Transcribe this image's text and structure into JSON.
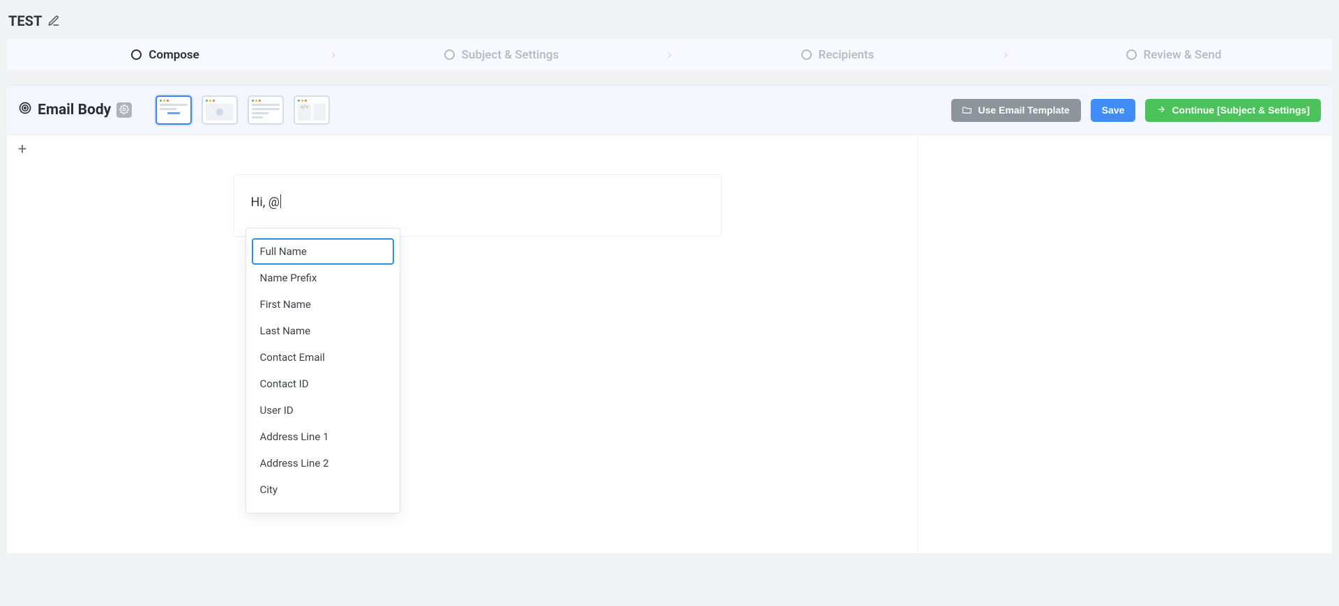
{
  "page_title": "TEST",
  "steps": [
    {
      "label": "Compose",
      "active": true
    },
    {
      "label": "Subject & Settings",
      "active": false
    },
    {
      "label": "Recipients",
      "active": false
    },
    {
      "label": "Review & Send",
      "active": false
    }
  ],
  "section_title": "Email Body",
  "buttons": {
    "use_template": "Use Email Template",
    "save": "Save",
    "continue": "Continue [Subject & Settings]"
  },
  "editor": {
    "text": "Hi, @"
  },
  "autocomplete": {
    "items": [
      "Full Name",
      "Name Prefix",
      "First Name",
      "Last Name",
      "Contact Email",
      "Contact ID",
      "User ID",
      "Address Line 1",
      "Address Line 2",
      "City"
    ],
    "selected_index": 0
  }
}
